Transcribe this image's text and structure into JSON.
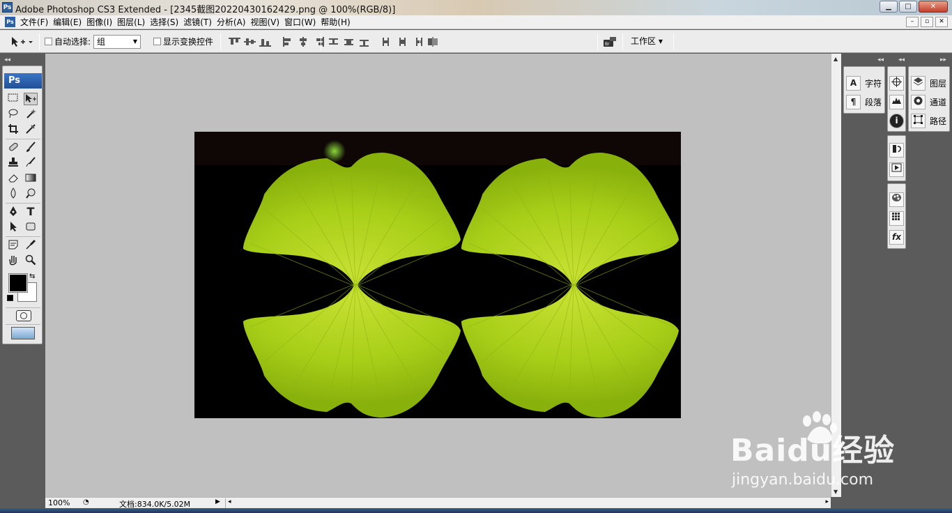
{
  "window": {
    "title": "Adobe Photoshop CS3 Extended - [2345截图20220430162429.png @ 100%(RGB/8)]",
    "app_icon": "Ps",
    "buttons": {
      "minimize": "▁",
      "maximize": "□",
      "close": "✕"
    }
  },
  "menubar": {
    "doc_icon": "Ps",
    "items": [
      "文件(F)",
      "编辑(E)",
      "图像(I)",
      "图层(L)",
      "选择(S)",
      "滤镜(T)",
      "分析(A)",
      "视图(V)",
      "窗口(W)",
      "帮助(H)"
    ],
    "mdi_buttons": [
      "–",
      "▫",
      "✕"
    ]
  },
  "options": {
    "auto_select_label": "自动选择:",
    "auto_select_value": "组",
    "show_transform_label": "显示变换控件",
    "workspace_label": "工作区 ▾"
  },
  "toolbox": {
    "badge": "Ps",
    "tools": [
      "marquee-icon",
      "move-icon",
      "lasso-icon",
      "magic-wand-icon",
      "crop-icon",
      "slice-icon",
      "healing-icon",
      "brush-icon",
      "stamp-icon",
      "history-brush-icon",
      "eraser-icon",
      "gradient-icon",
      "blur-icon",
      "dodge-icon",
      "pen-icon",
      "type-icon",
      "path-select-icon",
      "shape-icon",
      "notes-icon",
      "eyedropper-icon",
      "hand-icon",
      "zoom-icon"
    ],
    "type_glyph": "T",
    "foreground_color": "#000000",
    "background_color": "#ffffff"
  },
  "document": {
    "image_description_colors": {
      "background": "#000000",
      "leaf": "#a9d11a"
    }
  },
  "status": {
    "zoom": "100%",
    "doc_info": "文档:834.0K/5.02M"
  },
  "panels": {
    "group1": [
      {
        "icon": "A",
        "label": "字符"
      },
      {
        "icon": "¶",
        "label": "段落"
      }
    ],
    "group3": [
      {
        "icon": "◈",
        "label": "图层"
      },
      {
        "icon": "◉",
        "label": "通道"
      },
      {
        "icon": "⬚",
        "label": "路径"
      }
    ]
  },
  "watermark": {
    "main": "Baidu经验",
    "sub": "jingyan.baidu.com"
  }
}
